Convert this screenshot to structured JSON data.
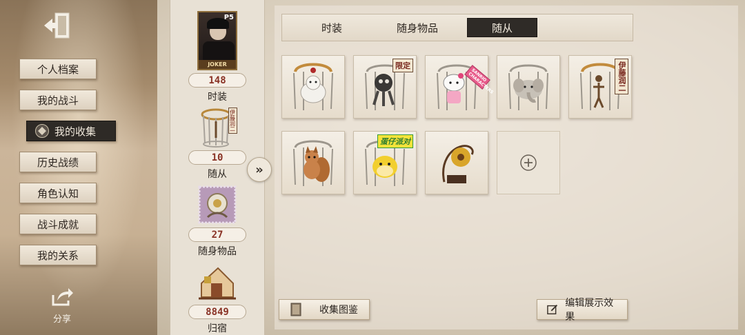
{
  "sidebar": {
    "items": [
      {
        "label": "个人档案"
      },
      {
        "label": "我的战斗"
      },
      {
        "label": "我的收集",
        "active": true
      },
      {
        "label": "历史战绩"
      },
      {
        "label": "角色认知"
      },
      {
        "label": "战斗成就"
      },
      {
        "label": "我的关系"
      }
    ],
    "share_label": "分享"
  },
  "summary": {
    "character_tag": "JOKER",
    "character_logo": "P5",
    "items": [
      {
        "count": "148",
        "label": "时装"
      },
      {
        "count": "10",
        "label": "随从",
        "tag": "伊藤润二"
      },
      {
        "count": "27",
        "label": "随身物品"
      },
      {
        "count": "8849",
        "label": "归宿"
      }
    ]
  },
  "tabs": [
    {
      "label": "时装"
    },
    {
      "label": "随身物品"
    },
    {
      "label": "随从",
      "active": true
    }
  ],
  "companions": [
    {
      "icon": "white-fox-companion-icon"
    },
    {
      "icon": "shadow-creature-companion-icon",
      "tag": "限定"
    },
    {
      "icon": "hello-kitty-companion-icon",
      "tag": "SANRIO CHARACTERS"
    },
    {
      "icon": "elephant-companion-icon"
    },
    {
      "icon": "marionette-companion-icon",
      "tag": "伊藤润二"
    },
    {
      "icon": "fox-squirrel-companion-icon"
    },
    {
      "icon": "yellow-ball-companion-icon",
      "tag": "蛋仔派对"
    },
    {
      "icon": "gramophone-flower-companion-icon"
    },
    {
      "icon": "add-slot-icon",
      "empty": true
    }
  ],
  "buttons": {
    "collection_guide": "收集图鉴",
    "edit_display": "编辑展示效果"
  },
  "colors": {
    "count_text": "#8a3326",
    "active_tab": "#2f2b27"
  }
}
